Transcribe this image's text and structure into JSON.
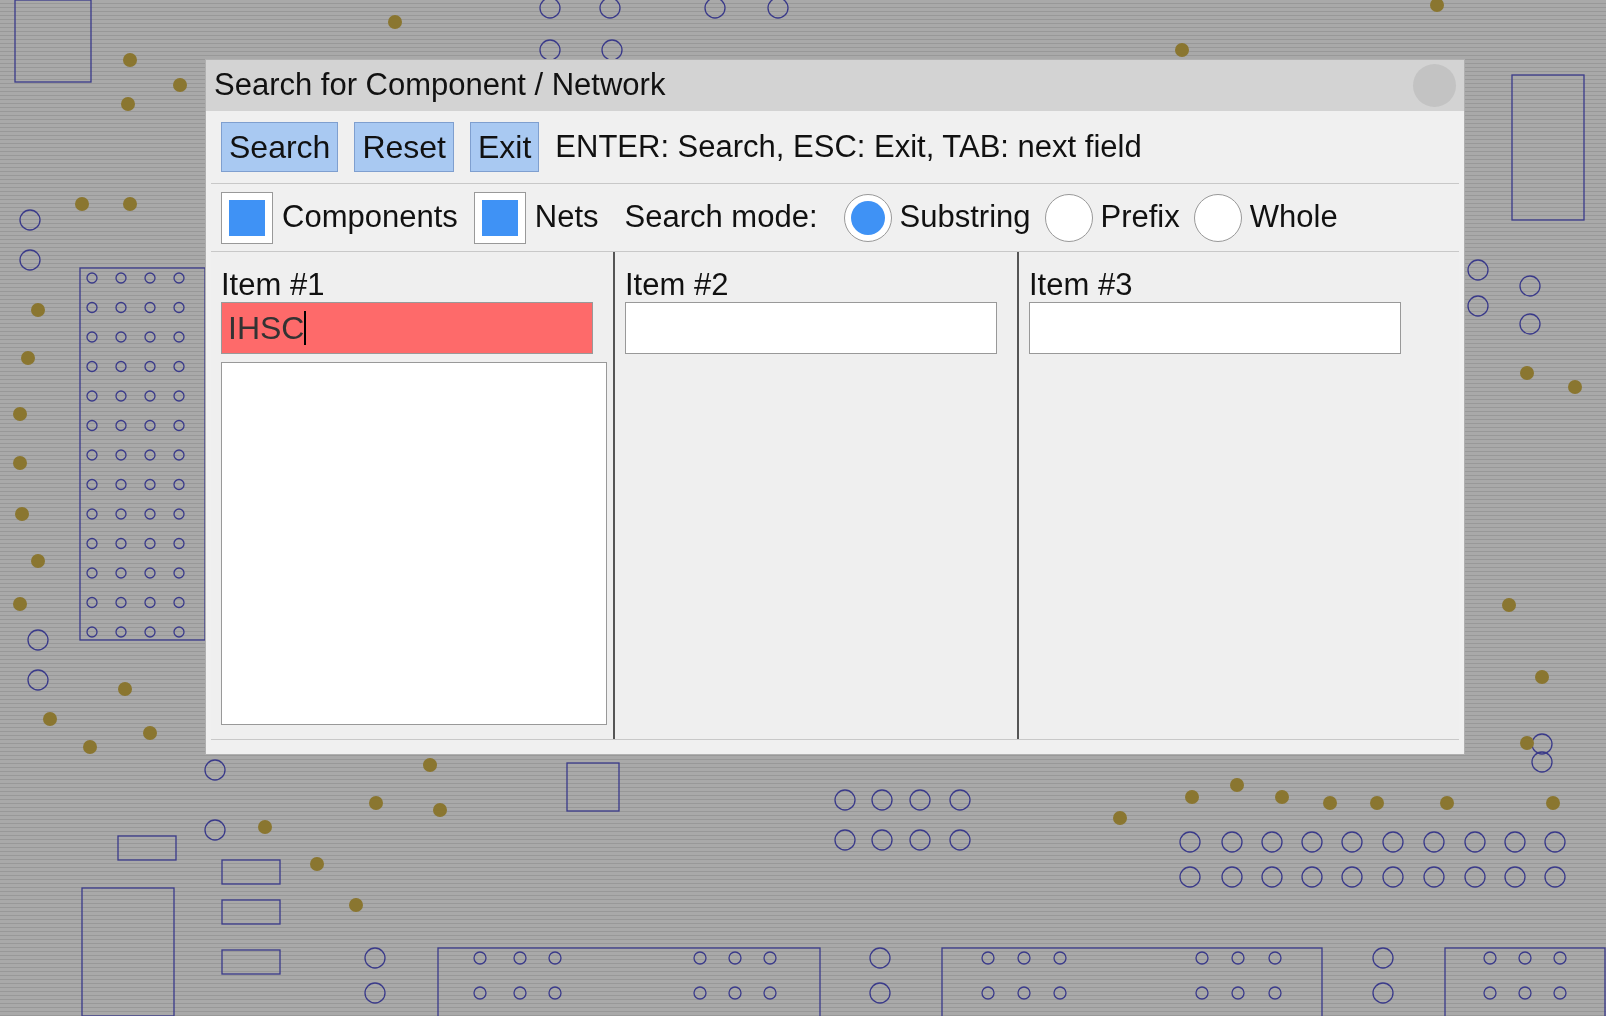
{
  "window": {
    "title": "Search for Component / Network"
  },
  "toolbar": {
    "buttons": [
      "Search",
      "Reset",
      "Exit"
    ],
    "hint": "ENTER: Search, ESC: Exit, TAB: next field"
  },
  "filters": [
    {
      "label": "Components",
      "checked": true
    },
    {
      "label": "Nets",
      "checked": true
    }
  ],
  "search_mode": {
    "label": "Search mode:",
    "options": [
      {
        "label": "Substring",
        "selected": true
      },
      {
        "label": "Prefix",
        "selected": false
      },
      {
        "label": "Whole",
        "selected": false
      }
    ]
  },
  "items": [
    {
      "label": "Item #1",
      "value": "IHSC",
      "invalid": true,
      "focused": true,
      "results_list": true
    },
    {
      "label": "Item #2",
      "invalid": false,
      "focused": false,
      "results_list": false
    },
    {
      "label": "Item #3",
      "invalid": false,
      "focused": false,
      "results_list": false
    }
  ]
}
